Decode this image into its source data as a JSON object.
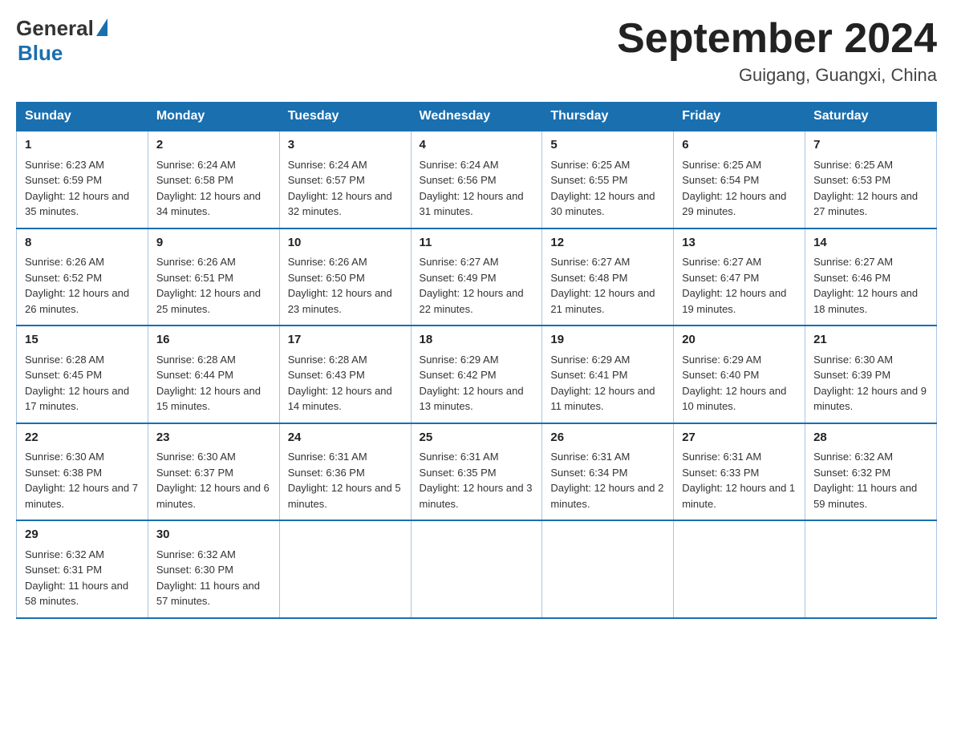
{
  "logo": {
    "general": "General",
    "blue": "Blue"
  },
  "title": "September 2024",
  "location": "Guigang, Guangxi, China",
  "weekdays": [
    "Sunday",
    "Monday",
    "Tuesday",
    "Wednesday",
    "Thursday",
    "Friday",
    "Saturday"
  ],
  "weeks": [
    [
      {
        "day": "1",
        "sunrise": "6:23 AM",
        "sunset": "6:59 PM",
        "daylight": "12 hours and 35 minutes."
      },
      {
        "day": "2",
        "sunrise": "6:24 AM",
        "sunset": "6:58 PM",
        "daylight": "12 hours and 34 minutes."
      },
      {
        "day": "3",
        "sunrise": "6:24 AM",
        "sunset": "6:57 PM",
        "daylight": "12 hours and 32 minutes."
      },
      {
        "day": "4",
        "sunrise": "6:24 AM",
        "sunset": "6:56 PM",
        "daylight": "12 hours and 31 minutes."
      },
      {
        "day": "5",
        "sunrise": "6:25 AM",
        "sunset": "6:55 PM",
        "daylight": "12 hours and 30 minutes."
      },
      {
        "day": "6",
        "sunrise": "6:25 AM",
        "sunset": "6:54 PM",
        "daylight": "12 hours and 29 minutes."
      },
      {
        "day": "7",
        "sunrise": "6:25 AM",
        "sunset": "6:53 PM",
        "daylight": "12 hours and 27 minutes."
      }
    ],
    [
      {
        "day": "8",
        "sunrise": "6:26 AM",
        "sunset": "6:52 PM",
        "daylight": "12 hours and 26 minutes."
      },
      {
        "day": "9",
        "sunrise": "6:26 AM",
        "sunset": "6:51 PM",
        "daylight": "12 hours and 25 minutes."
      },
      {
        "day": "10",
        "sunrise": "6:26 AM",
        "sunset": "6:50 PM",
        "daylight": "12 hours and 23 minutes."
      },
      {
        "day": "11",
        "sunrise": "6:27 AM",
        "sunset": "6:49 PM",
        "daylight": "12 hours and 22 minutes."
      },
      {
        "day": "12",
        "sunrise": "6:27 AM",
        "sunset": "6:48 PM",
        "daylight": "12 hours and 21 minutes."
      },
      {
        "day": "13",
        "sunrise": "6:27 AM",
        "sunset": "6:47 PM",
        "daylight": "12 hours and 19 minutes."
      },
      {
        "day": "14",
        "sunrise": "6:27 AM",
        "sunset": "6:46 PM",
        "daylight": "12 hours and 18 minutes."
      }
    ],
    [
      {
        "day": "15",
        "sunrise": "6:28 AM",
        "sunset": "6:45 PM",
        "daylight": "12 hours and 17 minutes."
      },
      {
        "day": "16",
        "sunrise": "6:28 AM",
        "sunset": "6:44 PM",
        "daylight": "12 hours and 15 minutes."
      },
      {
        "day": "17",
        "sunrise": "6:28 AM",
        "sunset": "6:43 PM",
        "daylight": "12 hours and 14 minutes."
      },
      {
        "day": "18",
        "sunrise": "6:29 AM",
        "sunset": "6:42 PM",
        "daylight": "12 hours and 13 minutes."
      },
      {
        "day": "19",
        "sunrise": "6:29 AM",
        "sunset": "6:41 PM",
        "daylight": "12 hours and 11 minutes."
      },
      {
        "day": "20",
        "sunrise": "6:29 AM",
        "sunset": "6:40 PM",
        "daylight": "12 hours and 10 minutes."
      },
      {
        "day": "21",
        "sunrise": "6:30 AM",
        "sunset": "6:39 PM",
        "daylight": "12 hours and 9 minutes."
      }
    ],
    [
      {
        "day": "22",
        "sunrise": "6:30 AM",
        "sunset": "6:38 PM",
        "daylight": "12 hours and 7 minutes."
      },
      {
        "day": "23",
        "sunrise": "6:30 AM",
        "sunset": "6:37 PM",
        "daylight": "12 hours and 6 minutes."
      },
      {
        "day": "24",
        "sunrise": "6:31 AM",
        "sunset": "6:36 PM",
        "daylight": "12 hours and 5 minutes."
      },
      {
        "day": "25",
        "sunrise": "6:31 AM",
        "sunset": "6:35 PM",
        "daylight": "12 hours and 3 minutes."
      },
      {
        "day": "26",
        "sunrise": "6:31 AM",
        "sunset": "6:34 PM",
        "daylight": "12 hours and 2 minutes."
      },
      {
        "day": "27",
        "sunrise": "6:31 AM",
        "sunset": "6:33 PM",
        "daylight": "12 hours and 1 minute."
      },
      {
        "day": "28",
        "sunrise": "6:32 AM",
        "sunset": "6:32 PM",
        "daylight": "11 hours and 59 minutes."
      }
    ],
    [
      {
        "day": "29",
        "sunrise": "6:32 AM",
        "sunset": "6:31 PM",
        "daylight": "11 hours and 58 minutes."
      },
      {
        "day": "30",
        "sunrise": "6:32 AM",
        "sunset": "6:30 PM",
        "daylight": "11 hours and 57 minutes."
      },
      null,
      null,
      null,
      null,
      null
    ]
  ],
  "labels": {
    "sunrise": "Sunrise:",
    "sunset": "Sunset:",
    "daylight": "Daylight:"
  }
}
